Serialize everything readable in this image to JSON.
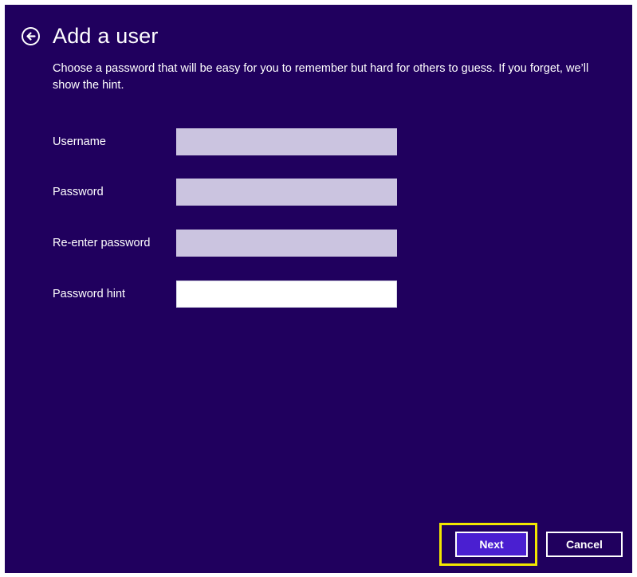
{
  "header": {
    "title": "Add a user",
    "back_icon": "back-arrow-circle-icon"
  },
  "instructions": "Choose a password that will be easy for you to remember but hard for others to guess. If you forget, we’ll show the hint.",
  "form": {
    "username_label": "Username",
    "username_value": "",
    "password_label": "Password",
    "password_value": "",
    "reenter_label": "Re-enter password",
    "reenter_value": "",
    "hint_label": "Password hint",
    "hint_value": ""
  },
  "buttons": {
    "next_label": "Next",
    "cancel_label": "Cancel"
  },
  "colors": {
    "background": "#20005e",
    "input_fill": "#cbc4e0",
    "next_fill": "#4a1fd1",
    "highlight": "#f2e600"
  }
}
